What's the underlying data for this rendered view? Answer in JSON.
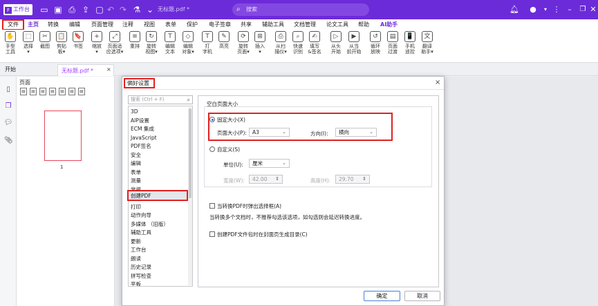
{
  "app": {
    "name": "工作台",
    "logo": "F"
  },
  "document": {
    "title": "无标题.pdf *"
  },
  "search": {
    "placeholder": "搜索"
  },
  "menu": {
    "file": "文件",
    "items": [
      "主页",
      "转换",
      "编辑",
      "页面管理",
      "注释",
      "视图",
      "表单",
      "保护",
      "电子签章",
      "共享",
      "辅助工具",
      "文档管理",
      "论文工具",
      "帮助",
      "AI助手"
    ]
  },
  "ribbon": [
    {
      "icon": "hand-icon",
      "glyph": "✋",
      "label": "手型\n工具"
    },
    {
      "icon": "select-icon",
      "glyph": "⬚",
      "label": "选择\n▾"
    },
    {
      "icon": "screenshot-icon",
      "glyph": "✂",
      "label": "截图"
    },
    {
      "icon": "clipboard-icon",
      "glyph": "📋",
      "label": "剪贴\n板▾"
    },
    {
      "icon": "bookmark-icon",
      "glyph": "🔖",
      "label": "书签"
    },
    {
      "icon": "zoom-icon",
      "glyph": "+",
      "label": "缩放\n▾"
    },
    {
      "icon": "fit-page-icon",
      "glyph": "⤢",
      "label": "页面适\n应选项▾"
    },
    {
      "icon": "reflow-icon",
      "glyph": "≡",
      "label": "重排"
    },
    {
      "icon": "rotate-view-icon",
      "glyph": "↻",
      "label": "旋转\n视图▾"
    },
    {
      "icon": "edit-text-icon",
      "glyph": "T",
      "label": "编辑\n文本"
    },
    {
      "icon": "edit-object-icon",
      "glyph": "◇",
      "label": "编辑\n对象▾"
    },
    {
      "icon": "typewriter-icon",
      "glyph": "T",
      "label": "打\n字机"
    },
    {
      "icon": "highlight-icon",
      "glyph": "✎",
      "label": "高亮"
    },
    {
      "icon": "rotate-page-icon",
      "glyph": "⟳",
      "label": "旋转\n页面▾"
    },
    {
      "icon": "insert-icon",
      "glyph": "⊞",
      "label": "插入\n▾"
    },
    {
      "icon": "scan-icon",
      "glyph": "⎙",
      "label": "从扫\n描仪▾"
    },
    {
      "icon": "ocr-icon",
      "glyph": "⌕",
      "label": "快速\n识别"
    },
    {
      "icon": "sign-icon",
      "glyph": "✍",
      "label": "填写\n&签名"
    },
    {
      "icon": "play-icon",
      "glyph": "▷",
      "label": "从头\n开始"
    },
    {
      "icon": "play-current-icon",
      "glyph": "▶",
      "label": "从当\n前开始"
    },
    {
      "icon": "loop-icon",
      "glyph": "↺",
      "label": "循环\n放映"
    },
    {
      "icon": "page-transition-icon",
      "glyph": "▤",
      "label": "页面\n过渡"
    },
    {
      "icon": "remote-icon",
      "glyph": "📱",
      "label": "手机\n遥控"
    },
    {
      "icon": "translate-icon",
      "glyph": "文",
      "label": "翻译\n助手▾"
    }
  ],
  "tabs": {
    "start": "开始",
    "doc": "无标题.pdf *",
    "close": "×"
  },
  "pages_panel": {
    "title": "页面",
    "page_number": "1"
  },
  "dialog": {
    "title": "偏好设置",
    "close": "×",
    "search_placeholder": "搜索 (Ctrl + F)",
    "categories": [
      "3D",
      "AIP设置",
      "ECM 集成",
      "JavaScript",
      "PDF签名",
      "安全",
      "编辑",
      "表单",
      "测量",
      "常规",
      "创建PDF",
      "打印",
      "动作向导",
      "多媒体 （旧版）",
      "辅助工具",
      "更新",
      "工作台",
      "朗读",
      "历史记录",
      "拼写检查",
      "平板"
    ],
    "selected_category": "创建PDF",
    "group_title": "空白页面大小",
    "fixed_size": "固定大小(X)",
    "page_size_label": "页面大小(P):",
    "page_size_value": "A3",
    "orientation_label": "方向(I):",
    "orientation_value": "横向",
    "custom": "自定义(S)",
    "unit_label": "单位(U):",
    "unit_value": "厘米",
    "width_label": "宽度(W):",
    "width_value": "42.00",
    "height_label": "高度(H):",
    "height_value": "29.70",
    "check1": "当转换PDF时弹出选择框(A)",
    "check1_note": "当转换多个文档时，不推荐勾选该选项，如勾选则会延迟转换进度。",
    "check2": "创建PDF文件包时在封面页生成目录(C)",
    "ok": "确定",
    "cancel": "取消"
  }
}
